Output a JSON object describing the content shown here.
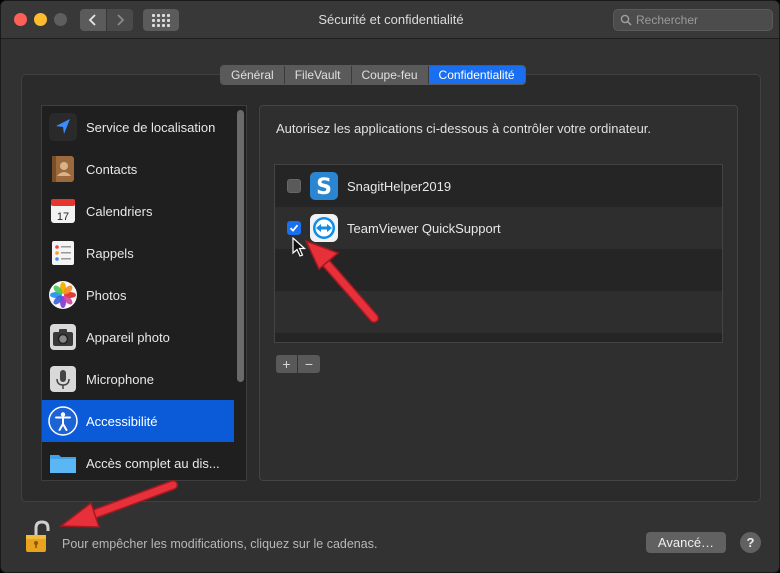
{
  "window": {
    "title": "Sécurité et confidentialité"
  },
  "search": {
    "placeholder": "Rechercher"
  },
  "tabs": [
    {
      "label": "Général",
      "active": false
    },
    {
      "label": "FileVault",
      "active": false
    },
    {
      "label": "Coupe-feu",
      "active": false
    },
    {
      "label": "Confidentialité",
      "active": true
    }
  ],
  "sidebar": {
    "items": [
      {
        "label": "Service de localisation",
        "icon": "location-arrow-icon",
        "selected": false
      },
      {
        "label": "Contacts",
        "icon": "contacts-book-icon",
        "selected": false
      },
      {
        "label": "Calendriers",
        "icon": "calendar-icon",
        "day": "17",
        "selected": false
      },
      {
        "label": "Rappels",
        "icon": "reminders-list-icon",
        "selected": false
      },
      {
        "label": "Photos",
        "icon": "photos-flower-icon",
        "selected": false
      },
      {
        "label": "Appareil photo",
        "icon": "camera-icon",
        "selected": false
      },
      {
        "label": "Microphone",
        "icon": "microphone-icon",
        "selected": false
      },
      {
        "label": "Accessibilité",
        "icon": "accessibility-icon",
        "selected": true
      },
      {
        "label": "Accès complet au dis...",
        "icon": "folder-icon",
        "selected": false
      }
    ]
  },
  "panel": {
    "description": "Autorisez les applications ci-dessous à contrôler votre ordinateur.",
    "apps": [
      {
        "label": "SnagitHelper2019",
        "checked": false,
        "icon": "snagit-icon"
      },
      {
        "label": "TeamViewer QuickSupport",
        "checked": true,
        "icon": "teamviewer-icon"
      }
    ],
    "add_label": "+",
    "remove_label": "−"
  },
  "footer": {
    "lock_message": "Pour empêcher les modifications, cliquez sur le cadenas.",
    "advanced_label": "Avancé…",
    "help_label": "?"
  },
  "colors": {
    "accent": "#1a6ff0",
    "selection": "#0b5bd8",
    "annotation_arrow": "#e8303a"
  }
}
